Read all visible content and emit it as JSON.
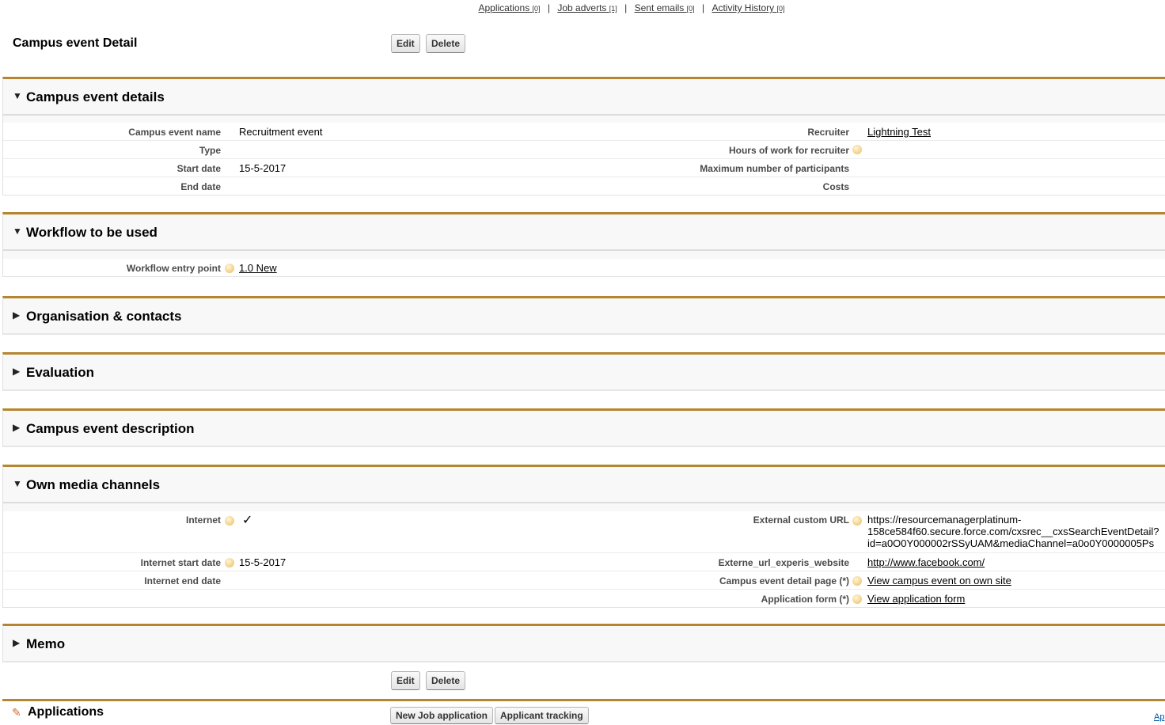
{
  "related_links": [
    {
      "label": "Applications",
      "count": "[0]"
    },
    {
      "label": "Job adverts",
      "count": "[1]"
    },
    {
      "label": "Sent emails",
      "count": "[0]"
    },
    {
      "label": "Activity History",
      "count": "[0]"
    }
  ],
  "separator": "|",
  "page_title": "Campus event Detail",
  "buttons": {
    "edit": "Edit",
    "delete": "Delete",
    "new_job_application": "New Job application",
    "applicant_tracking": "Applicant tracking"
  },
  "sections": {
    "details": {
      "title": "Campus event details",
      "campus_event_name_label": "Campus event name",
      "campus_event_name": "Recruitment event",
      "type_label": "Type",
      "type": "",
      "start_date_label": "Start date",
      "start_date": "15-5-2017",
      "end_date_label": "End date",
      "end_date": "",
      "recruiter_label": "Recruiter",
      "recruiter": "Lightning Test",
      "hours_label": "Hours of work for recruiter",
      "hours": "",
      "max_participants_label": "Maximum number of participants",
      "max_participants": "",
      "costs_label": "Costs",
      "costs": ""
    },
    "workflow": {
      "title": "Workflow to be used",
      "entry_point_label": "Workflow entry point",
      "entry_point": "1.0 New"
    },
    "organisation": {
      "title": "Organisation & contacts"
    },
    "evaluation": {
      "title": "Evaluation"
    },
    "description": {
      "title": "Campus event description"
    },
    "media": {
      "title": "Own media channels",
      "internet_label": "Internet",
      "internet_checked": true,
      "internet_start_label": "Internet start date",
      "internet_start": "15-5-2017",
      "internet_end_label": "Internet end date",
      "internet_end": "",
      "external_url_label": "External custom URL",
      "external_url_lines": [
        "https://resourcemanagerplatinum-",
        "158ce584f60.secure.force.com/cxsrec__cxsSearchEventDetail?",
        "id=a0O0Y000002rSSyUAM&mediaChannel=a0o0Y0000005Ps"
      ],
      "experis_label": "Externe_url_experis_website",
      "experis": "http://www.facebook.com/",
      "detail_page_label": "Campus event detail page (*)",
      "detail_page": "View campus event on own site",
      "app_form_label": "Application form (*)",
      "app_form": "View application form"
    },
    "memo": {
      "title": "Memo"
    }
  },
  "applications_title": "Applications",
  "corner_link": "Ap",
  "colors": {
    "section_border": "#b5852f",
    "header_bg": "#f8f8f8",
    "help_icon": "#f1cd82"
  }
}
